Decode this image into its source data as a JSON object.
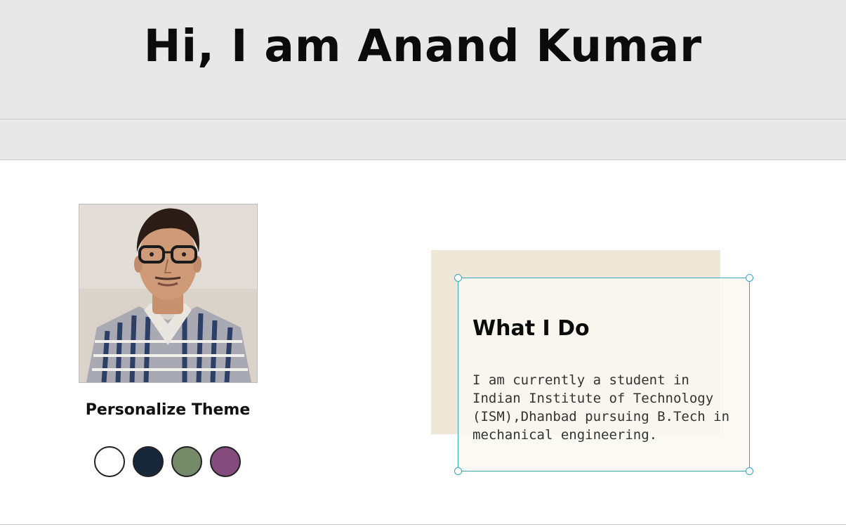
{
  "header": {
    "title": "Hi, I am Anand Kumar"
  },
  "profile": {
    "photo_icon": "profile-photo"
  },
  "theme": {
    "title": "Personalize Theme",
    "swatches": [
      {
        "name": "white",
        "color": "#ffffff"
      },
      {
        "name": "navy",
        "color": "#17283b"
      },
      {
        "name": "sage-green",
        "color": "#748a69"
      },
      {
        "name": "plum",
        "color": "#834c7d"
      }
    ]
  },
  "about": {
    "heading": "What I Do",
    "text": "I am currently a student in Indian Institute of Technology (ISM),Dhanbad pursuing B.Tech in mechanical engineering."
  }
}
